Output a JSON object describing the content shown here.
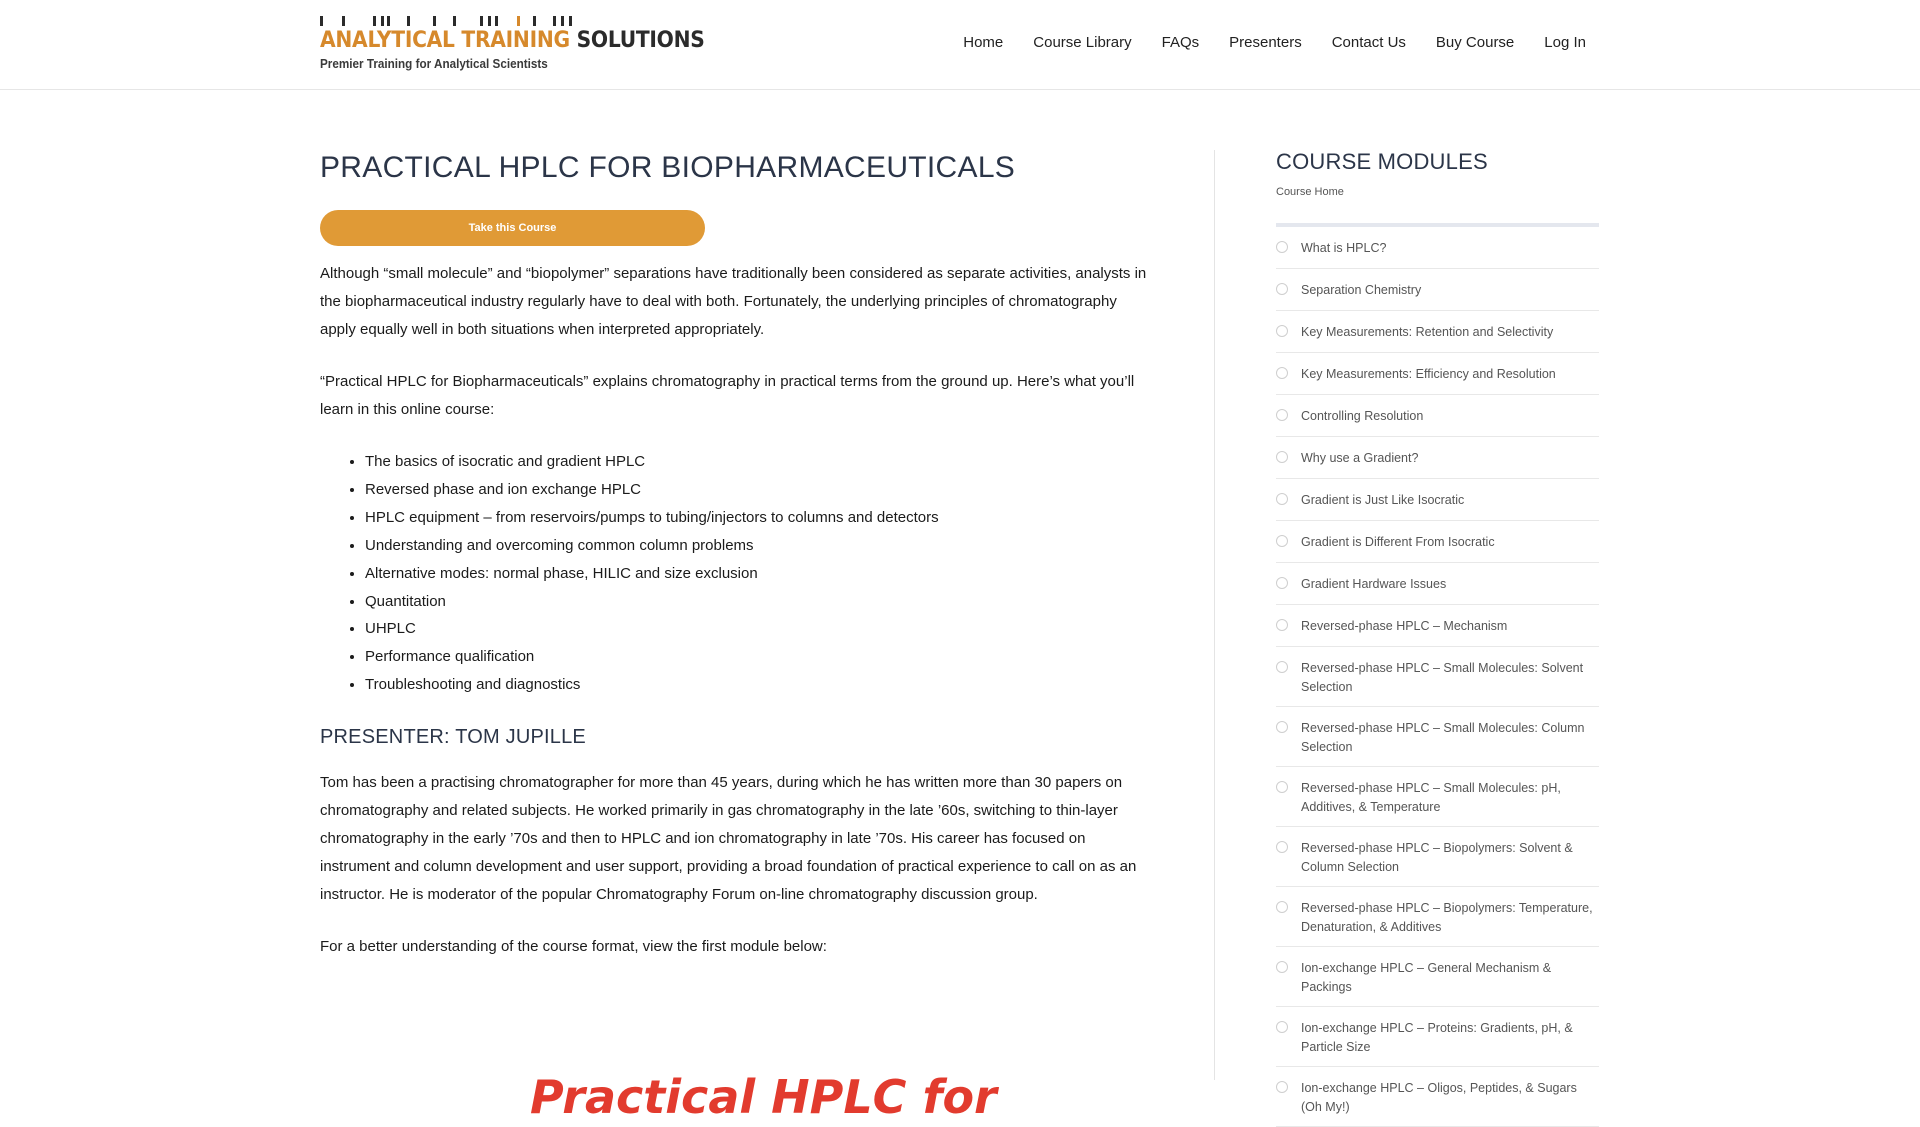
{
  "brand": {
    "name_part1": "ANALYTICAL TRAINING",
    "name_part2": "SOLUTIONS",
    "tagline": "Premier Training for Analytical Scientists",
    "accent_color": "#d6892c"
  },
  "nav": {
    "items": [
      "Home",
      "Course Library",
      "FAQs",
      "Presenters",
      "Contact Us",
      "Buy Course",
      "Log In"
    ]
  },
  "main": {
    "title": "PRACTICAL HPLC FOR BIOPHARMACEUTICALS",
    "cta_label": "Take this Course",
    "cta_color": "#e09a36",
    "intro_1": "Although “small molecule” and “biopolymer” separations have traditionally been considered as separate activities, analysts in the biopharmaceutical industry regularly have to deal with both. Fortunately, the underlying principles of chromatography apply equally well in both situations when interpreted appropriately.",
    "intro_2": "“Practical HPLC for Biopharmaceuticals” explains chromatography in practical terms from the ground up. Here’s what you’ll learn in this online course:",
    "topics": [
      "The basics of isocratic and gradient HPLC",
      "Reversed phase and ion exchange HPLC",
      "HPLC equipment – from reservoirs/pumps to tubing/injectors to columns and detectors",
      "Understanding and overcoming common column problems",
      "Alternative modes: normal phase, HILIC and size exclusion",
      "Quantitation",
      "UHPLC",
      "Performance qualification",
      "Troubleshooting and diagnostics"
    ],
    "presenter_heading": "PRESENTER: TOM JUPILLE",
    "presenter_bio": "Tom has been a practising chromatographer for more than 45 years, during which he has written more than 30 papers on chromatography and related subjects. He worked primarily in gas chromatography in the late ’60s, switching to thin-layer chromatography in the early ’70s and then to HPLC and ion chromatography in late ’70s. His career has focused on instrument and column development and user support, providing a broad foundation of practical experience to call on as an instructor. He is moderator of the popular Chromatography Forum on-line chromatography discussion group.",
    "video_intro": "For a better understanding of the course format, view the first module below:",
    "video_title_partial": "Practical HPLC for"
  },
  "sidebar": {
    "title": "COURSE MODULES",
    "course_home": "Course Home",
    "modules": [
      "What is HPLC?",
      "Separation Chemistry",
      "Key Measurements: Retention and Selectivity",
      "Key Measurements: Efficiency and Resolution",
      "Controlling Resolution",
      "Why use a Gradient?",
      "Gradient is Just Like Isocratic",
      "Gradient is Different From Isocratic",
      "Gradient Hardware Issues",
      "Reversed-phase HPLC – Mechanism",
      "Reversed-phase HPLC – Small Molecules: Solvent Selection",
      "Reversed-phase HPLC – Small Molecules: Column Selection",
      "Reversed-phase HPLC – Small Molecules: pH, Additives, & Temperature",
      "Reversed-phase HPLC – Biopolymers: Solvent & Column Selection",
      "Reversed-phase HPLC – Biopolymers: Temperature, Denaturation, & Additives",
      "Ion-exchange HPLC – General Mechanism & Packings",
      "Ion-exchange HPLC – Proteins: Gradients, pH, & Particle Size",
      "Ion-exchange HPLC – Oligos, Peptides, & Sugars (Oh My!)"
    ]
  }
}
